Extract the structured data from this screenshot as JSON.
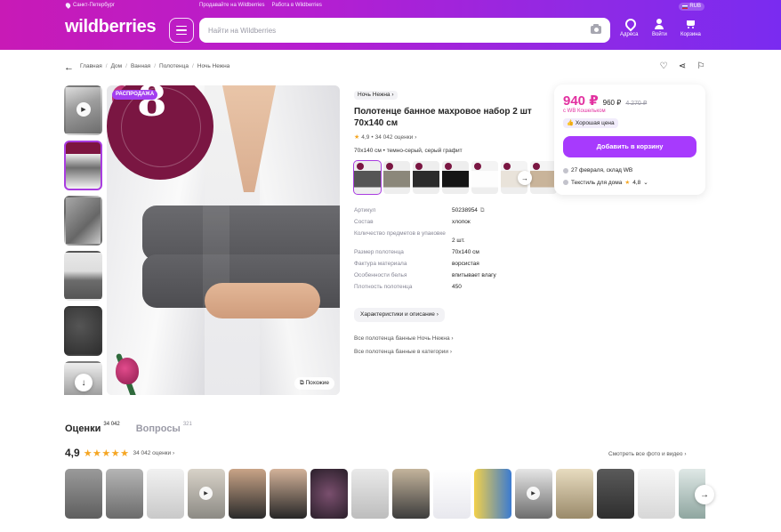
{
  "header": {
    "city": "Санкт-Петербург",
    "top_links": [
      "Продавайте на Wildberries",
      "Работа в Wildberries"
    ],
    "currency": "RUB",
    "logo": "wildberries",
    "search_placeholder": "Найти на Wildberries",
    "nav": [
      {
        "label": "Адреса",
        "icon": "address-icon"
      },
      {
        "label": "Войти",
        "icon": "user-icon"
      },
      {
        "label": "Корзина",
        "icon": "cart-icon"
      }
    ],
    "gradient_colors": [
      "#c81ab6",
      "#7a2bf0"
    ]
  },
  "breadcrumbs": [
    "Главная",
    "Дом",
    "Ванная",
    "Полотенца",
    "Ночь Нежна"
  ],
  "gallery": {
    "sale_badge": "РАСПРОДАЖА",
    "promo_number": "8",
    "similar_label": "Похожие"
  },
  "product": {
    "brand": "Ночь Нежна",
    "title": "Полотенце банное махровое набор 2 шт 70х140 см",
    "rating": "4,9",
    "reviews_count": "34 042 оценки",
    "variant": "70х140 см • темно-серый, серый графит",
    "specs": [
      {
        "label": "Артикул",
        "value": "50238954"
      },
      {
        "label": "Состав",
        "value": "хлопок"
      },
      {
        "label": "Количество предметов в упаковке",
        "value": "2 шт."
      },
      {
        "label": "Размер полотенца",
        "value": "70х140 см"
      },
      {
        "label": "Фактура материала",
        "value": "ворсистая"
      },
      {
        "label": "Особенности белья",
        "value": "впитывает влагу"
      },
      {
        "label": "Плотность полотенца",
        "value": "450"
      }
    ],
    "characteristics_button": "Характеристики и описание",
    "links": [
      "Все полотенца банные Ночь Нежна",
      "Все полотенца банные в категории"
    ]
  },
  "price": {
    "current": "940 ₽",
    "with_wallet": "960 ₽",
    "old": "4 270 ₽",
    "wallet_note": "с WB Кошельком",
    "good_price": "Хорошая цена",
    "add_to_cart": "Добавить в корзину",
    "delivery": "27 февраля, склад WB",
    "seller": "Текстиль для дома",
    "seller_rating": "4,8",
    "accent": "#e231a0",
    "button_color": "#a73afd"
  },
  "reviews": {
    "tab_reviews": "Оценки",
    "tab_reviews_count": "34 042",
    "tab_questions": "Вопросы",
    "tab_questions_count": "321",
    "score": "4,9",
    "stars": "★★★★★",
    "count": "34 042 оценки",
    "all_photos": "Смотреть все фото и видео"
  }
}
